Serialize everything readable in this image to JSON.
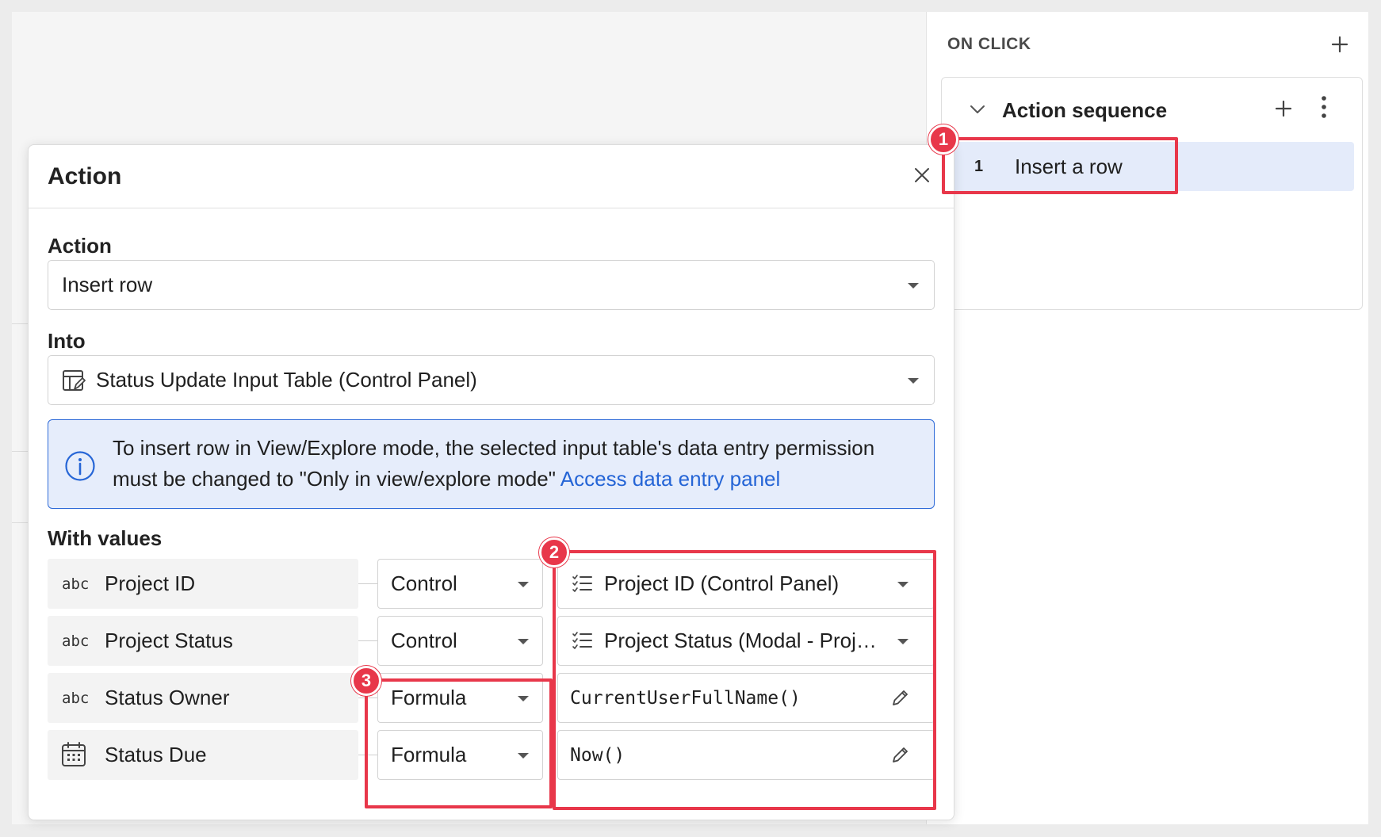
{
  "right_panel": {
    "title": "ON CLICK",
    "add_icon": "plus-icon",
    "sequence": {
      "title": "Action sequence",
      "items": [
        {
          "number": "1",
          "label": "Insert a row"
        }
      ]
    }
  },
  "modal": {
    "title": "Action",
    "action_label": "Action",
    "action_value": "Insert row",
    "into_label": "Into",
    "into_value": "Status Update Input Table (Control Panel)",
    "info_text": "To insert row in View/Explore mode, the selected input table's data entry permission must be changed to \"Only in view/explore mode\"",
    "info_link": "Access data entry panel",
    "values_label": "With values",
    "rows": [
      {
        "type": "abc",
        "name": "Project ID",
        "source": "Control",
        "value": "Project ID (Control Panel)",
        "value_icon": "list-icon"
      },
      {
        "type": "abc",
        "name": "Project Status",
        "source": "Control",
        "value": "Project Status (Modal - Proj…",
        "value_icon": "list-icon"
      },
      {
        "type": "abc",
        "name": "Status Owner",
        "source": "Formula",
        "value": "CurrentUserFullName()",
        "value_icon": "pencil-icon"
      },
      {
        "type": "calendar",
        "name": "Status Due",
        "source": "Formula",
        "value": "Now()",
        "value_icon": "pencil-icon"
      }
    ]
  },
  "annotations": {
    "badge_1": "1",
    "badge_2": "2",
    "badge_3": "3",
    "color": "#e8374a"
  }
}
